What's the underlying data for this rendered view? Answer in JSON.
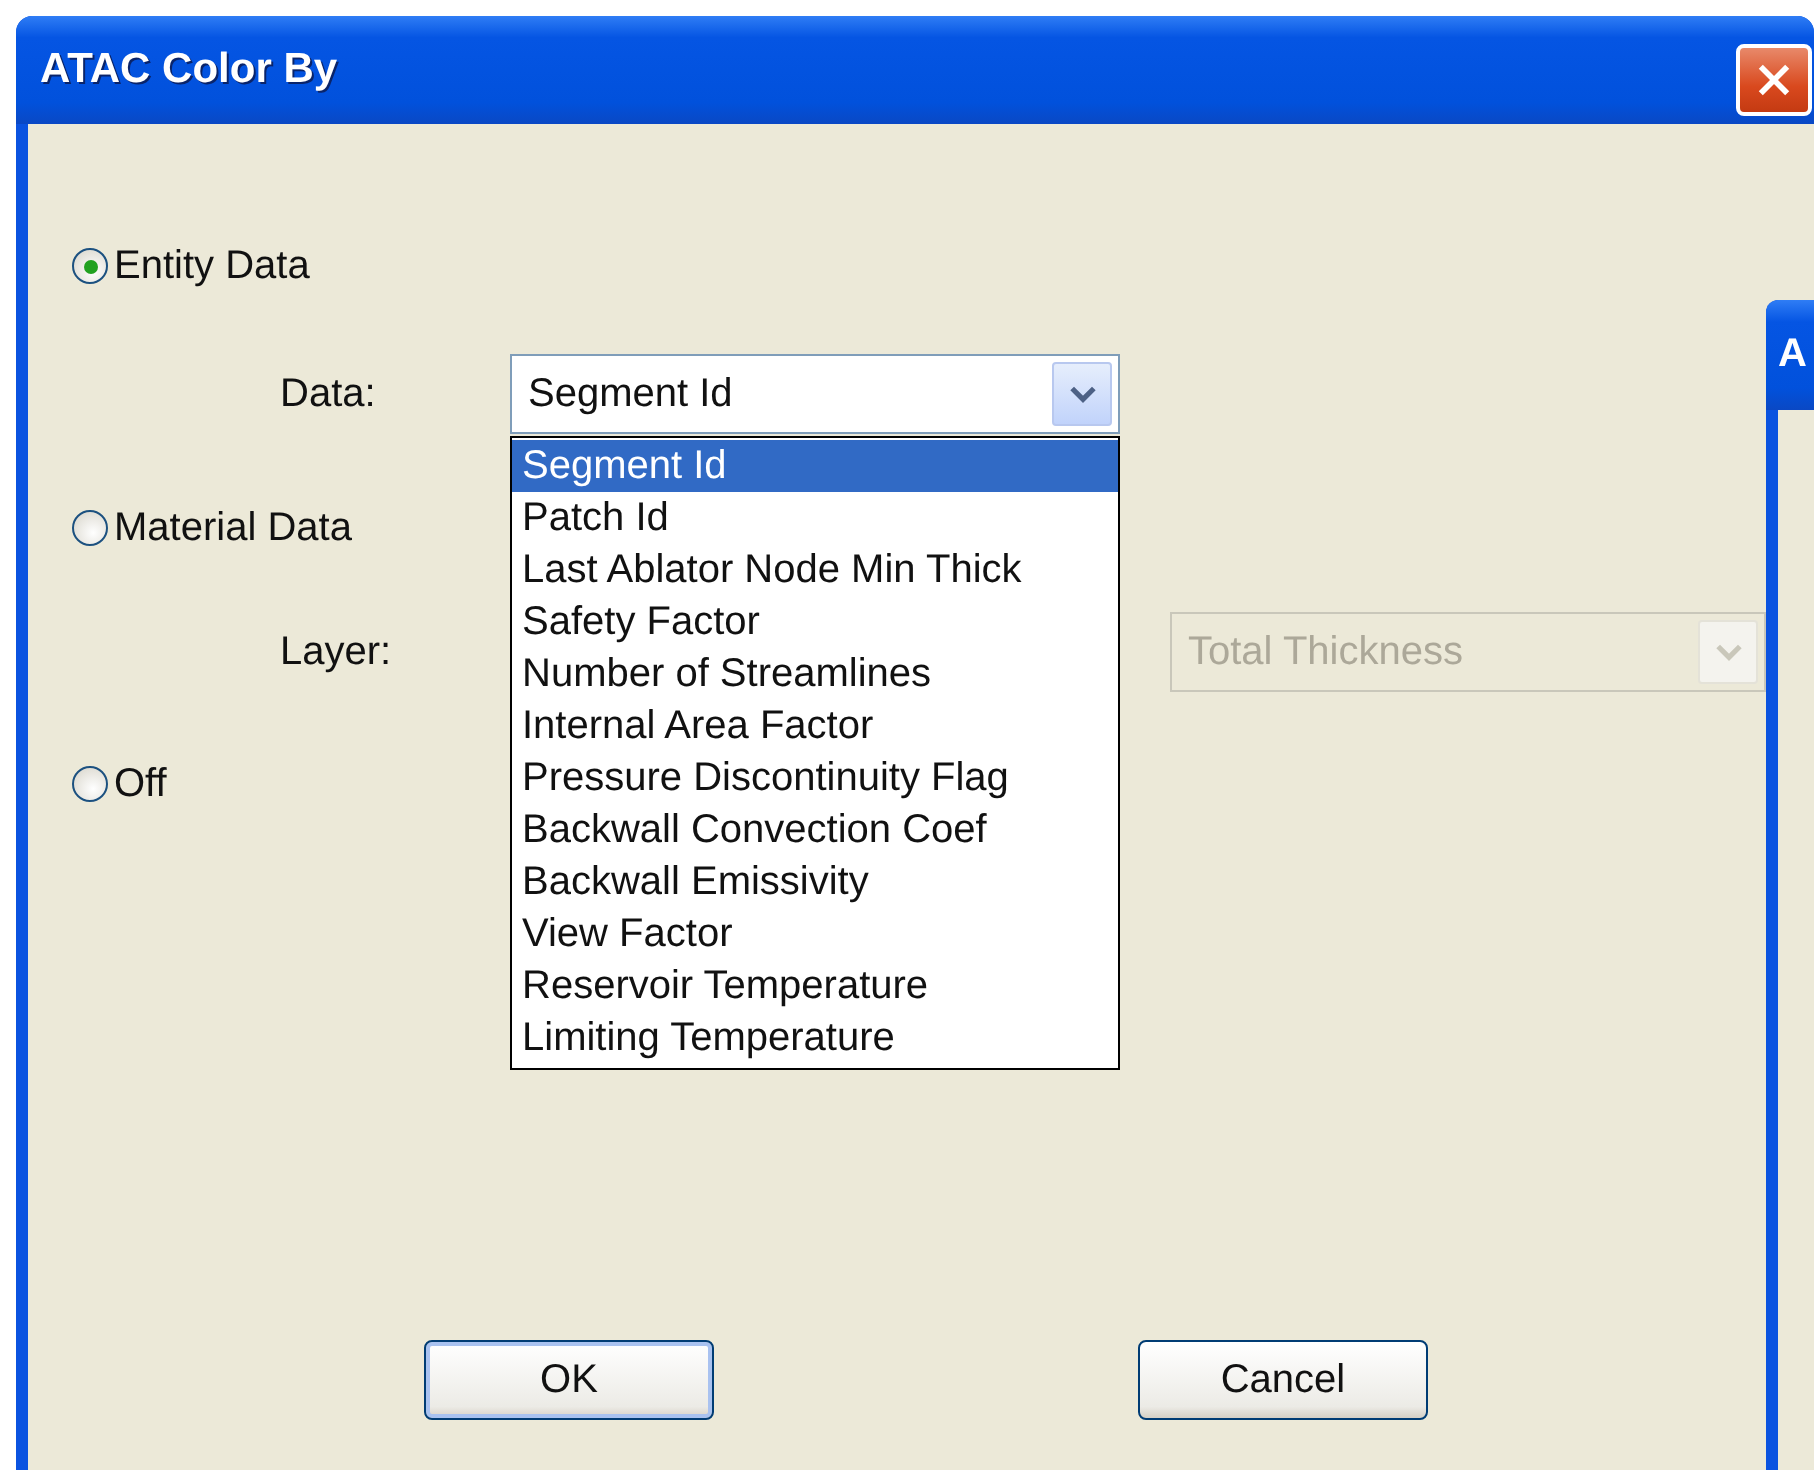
{
  "window": {
    "title": "ATAC Color By"
  },
  "color_by": [
    {
      "label": "Entity Data",
      "selected": true
    },
    {
      "label": "Material Data",
      "selected": false
    },
    {
      "label": "Off",
      "selected": false
    }
  ],
  "data_field": {
    "label": "Data:",
    "value": "Segment Id",
    "expanded": true,
    "options": [
      {
        "label": "Segment Id",
        "selected": true
      },
      {
        "label": "Patch Id",
        "selected": false
      },
      {
        "label": "Last Ablator Node Min Thick",
        "selected": false
      },
      {
        "label": "Safety Factor",
        "selected": false
      },
      {
        "label": "Number of Streamlines",
        "selected": false
      },
      {
        "label": "Internal Area Factor",
        "selected": false
      },
      {
        "label": "Pressure Discontinuity Flag",
        "selected": false
      },
      {
        "label": "Backwall Convection Coef",
        "selected": false
      },
      {
        "label": "Backwall Emissivity",
        "selected": false
      },
      {
        "label": "View Factor",
        "selected": false
      },
      {
        "label": "Reservoir Temperature",
        "selected": false
      },
      {
        "label": "Limiting Temperature",
        "selected": false
      }
    ]
  },
  "layer_field": {
    "label": "Layer:",
    "value": "Total Thickness",
    "disabled": true
  },
  "buttons": [
    {
      "label": "OK",
      "default": true
    },
    {
      "label": "Cancel",
      "default": false
    }
  ],
  "background_window": {
    "title": "A"
  }
}
